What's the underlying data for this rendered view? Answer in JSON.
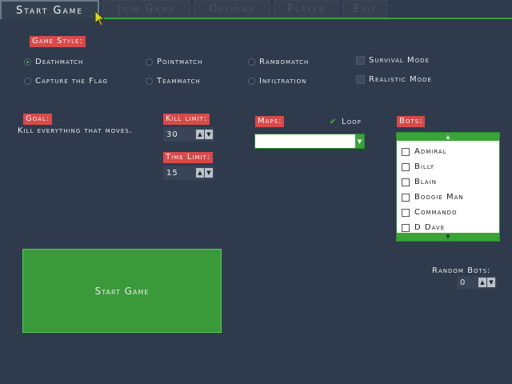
{
  "tabs": [
    {
      "label": "Start Game",
      "active": true
    },
    {
      "label": "Join Game",
      "active": false
    },
    {
      "label": "Options",
      "active": false
    },
    {
      "label": "Player",
      "active": false
    },
    {
      "label": "Exit",
      "active": false
    }
  ],
  "game_style": {
    "label": "Game Style:",
    "modes": [
      {
        "label": "Deathmatch",
        "selected": true
      },
      {
        "label": "Capture the Flag",
        "selected": false
      },
      {
        "label": "Pointmatch",
        "selected": false
      },
      {
        "label": "Teammatch",
        "selected": false
      },
      {
        "label": "Rambomatch",
        "selected": false
      },
      {
        "label": "Infiltration",
        "selected": false
      }
    ],
    "checks": [
      {
        "label": "Survival Mode",
        "checked": false
      },
      {
        "label": "Realistic Mode",
        "checked": false
      }
    ]
  },
  "goal": {
    "label": "Goal:",
    "text": "Kill everything that moves."
  },
  "kill_limit": {
    "label": "Kill limit:",
    "value": "30"
  },
  "time_limit": {
    "label": "Time Limit:",
    "value": "15"
  },
  "maps": {
    "label": "Maps:",
    "selected": "",
    "loop_label": "Loop",
    "loop_checked": true
  },
  "bots": {
    "label": "Bots:",
    "items": [
      "Admiral",
      "Billy",
      "Blain",
      "Boogie Man",
      "Commando",
      "D Dave"
    ]
  },
  "random_bots": {
    "label": "Random Bots:",
    "value": "0"
  },
  "start_button": {
    "label": "Start Game"
  },
  "colors": {
    "background": "#2f3a4d",
    "accent_green": "#3a9a3a",
    "label_red": "#d84a4a"
  }
}
